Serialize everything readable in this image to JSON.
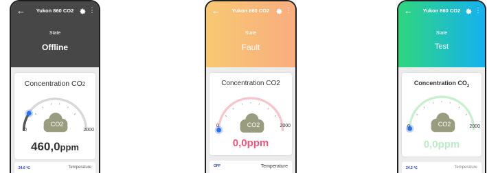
{
  "phones": [
    {
      "title": "Yukon 860 CO2",
      "state_label": "State",
      "state_value": "Offline",
      "card_title_main": "Concentration CO",
      "card_title_sub": "2",
      "gauge_min": "0",
      "gauge_max": "2000",
      "cloud_label": "CO2",
      "reading_value": "460,0",
      "reading_unit": "ppm",
      "gauge_level": 0.23,
      "strip_left": "24.6 ℃",
      "strip_right": "Temperature"
    },
    {
      "title": "Yukon 860 CO2",
      "state_label": "State",
      "state_value": "Fault",
      "card_title": "Concentration CO2",
      "gauge_min": "0",
      "gauge_max": "2000",
      "cloud_label": "CO2",
      "reading": "0,0ppm",
      "gauge_level": 0.0,
      "strip_left": "OFF",
      "strip_right": "Temperature"
    },
    {
      "title": "Yukon 860 CO2",
      "state_label": "State",
      "state_value": "Test",
      "card_title_main": "Concentration CO",
      "card_title_sub": "2",
      "gauge_min": "0",
      "gauge_max": "2000",
      "cloud_label": "CO2",
      "reading": "0,0ppm",
      "gauge_level": 0.0,
      "strip_left": "24.2 ℃",
      "strip_right": "Temperature"
    }
  ],
  "colors": {
    "phone1_header": "#474747",
    "phone2_header_start": "#f7c972",
    "phone2_header_end": "#f9ad7f",
    "phone3_header_start": "#2fd67d",
    "phone3_header_end": "#15b1f0",
    "phone1_arc": "#d8d8d8",
    "phone1_arc_fill": "#555555",
    "phone2_arc": "#f7c5cd",
    "phone3_arc": "#c9efcf",
    "gauge_dot": "#2a6ff0",
    "cloud": "#9a9c80",
    "phone1_reading": "#333333",
    "phone2_reading": "#f2547a",
    "phone3_reading": "#b9edc8"
  }
}
